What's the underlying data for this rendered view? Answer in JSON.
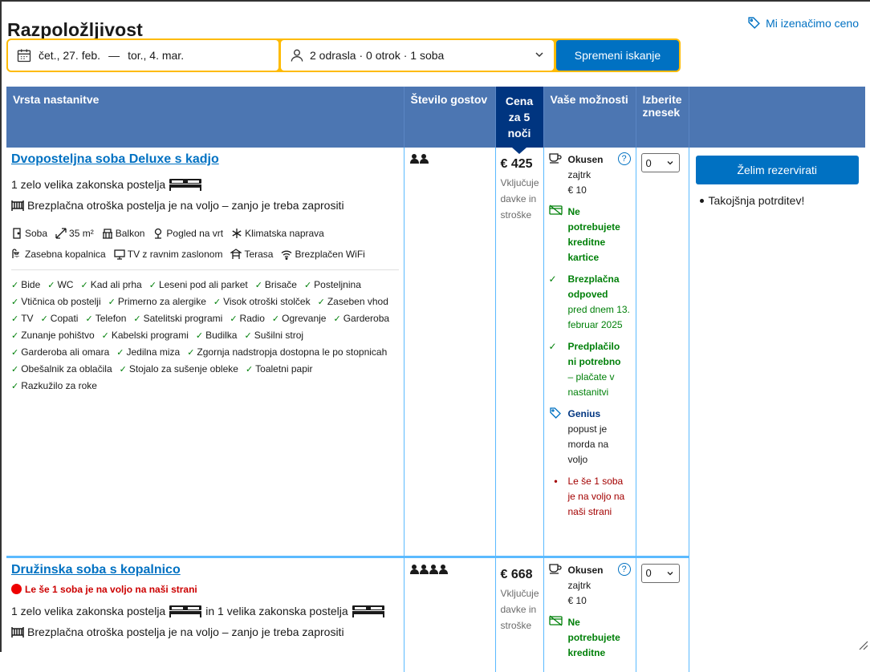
{
  "page_title": "Razpoložljivost",
  "price_match": "Mi izenačimo ceno",
  "search": {
    "checkin": "čet., 27. feb.",
    "dash": "—",
    "checkout": "tor., 4. mar.",
    "guests": "2 odrasla · 0 otrok · 1 soba",
    "button": "Spremeni iskanje"
  },
  "table": {
    "headers": {
      "room_type": "Vrsta nastanitve",
      "guests": "Število gostov",
      "price": "Cena za 5 noči",
      "options": "Vaše možnosti",
      "select": "Izberite znesek"
    }
  },
  "reserve": {
    "button": "Želim rezervirati",
    "instant": "Takojšnja potrditev!"
  },
  "rooms": [
    {
      "name": "Dvoposteljna soba Deluxe s kadjo",
      "bed": "1 zelo velika zakonska postelja",
      "crib": "Brezplačna otroška postelja je na voljo – zanjo je treba zaprositi",
      "facilities": [
        "Soba",
        "35 m²",
        "Balkon",
        "Pogled na vrt",
        "Klimatska naprava",
        "Zasebna kopalnica",
        "TV z ravnim zaslonom",
        "Terasa",
        "Brezplačen WiFi"
      ],
      "amenities": [
        "Bide",
        "WC",
        "Kad ali prha",
        "Leseni pod ali parket",
        "Brisače",
        "Posteljnina",
        "Vtičnica ob postelji",
        "Primerno za alergike",
        "Visok otroški stolček",
        "Zaseben vhod",
        "TV",
        "Copati",
        "Telefon",
        "Satelitski programi",
        "Radio",
        "Ogrevanje",
        "Garderoba",
        "Zunanje pohištvo",
        "Kabelski programi",
        "Budilka",
        "Sušilni stroj",
        "Garderoba ali omara",
        "Jedilna miza",
        "Zgornja nadstropja dostopna le po stopnicah",
        "Obešalnik za oblačila",
        "Stojalo za sušenje obleke",
        "Toaletni papir",
        "Razkužilo za roke"
      ],
      "price": "€ 425",
      "tax": "Vključuje davke in stroške",
      "opt_breakfast_title": "Okusen",
      "opt_breakfast_sub": "zajtrk",
      "opt_breakfast_price": "€ 10",
      "opt_card": "Ne potrebujete kreditne kartice",
      "opt_cancel": "Brezplačna odpoved",
      "opt_cancel_sub": "pred dnem 13. februar 2025",
      "opt_prepay": "Predplačilo ni potrebno",
      "opt_prepay_sub": "– plačate v nastanitvi",
      "opt_genius": "Genius",
      "opt_genius_sub": "popust je morda na voljo",
      "opt_scarce": "Le še 1 soba je na voljo na naši strani",
      "select": "0"
    },
    {
      "name": "Družinska soba s kopalnico",
      "scarce": "Le še 1 soba je na voljo na naši strani",
      "bed_a": "1 zelo velika zakonska postelja",
      "bed_join": "in 1 velika zakonska postelja",
      "crib": "Brezplačna otroška postelja je na voljo – zanjo je treba zaprositi",
      "price": "€ 668",
      "tax": "Vključuje davke in stroške",
      "opt_breakfast_title": "Okusen",
      "opt_breakfast_sub": "zajtrk",
      "opt_breakfast_price": "€ 10",
      "opt_card": "Ne potrebujete kreditne",
      "select": "0"
    }
  ],
  "colors": {
    "accent": "#0071c2",
    "header": "#4c76b2",
    "dark_blue": "#003580",
    "yellow": "#febb02",
    "green": "#008009"
  }
}
